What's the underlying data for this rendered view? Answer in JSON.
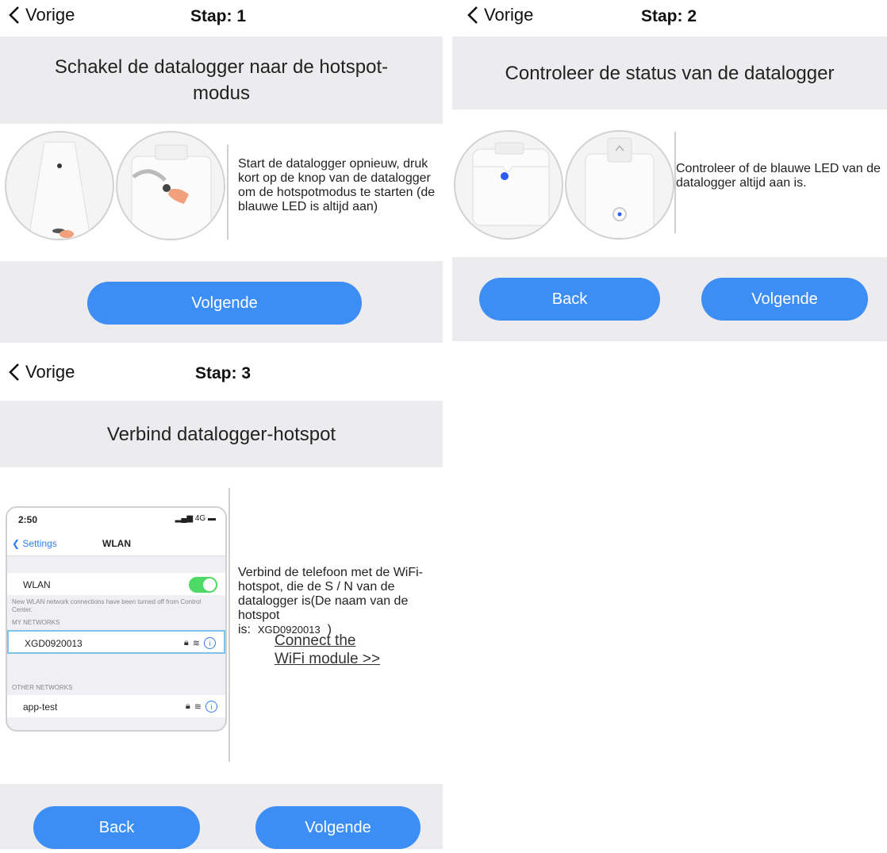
{
  "step1": {
    "back_label": "Vorige",
    "step_title": "Stap: 1",
    "header": "Schakel de datalogger naar de hotspot-modus",
    "description": "Start de datalogger opnieuw, druk kort op de knop van de datalogger om de hotspotmodus te starten (de blauwe LED is altijd aan)",
    "next_label": "Volgende"
  },
  "step2": {
    "back_label": "Vorige",
    "step_title": "Stap: 2",
    "header": "Controleer de status van de datalogger",
    "description": "Controleer of de blauwe LED van de datalogger altijd aan is.",
    "back_button_label": "Back",
    "next_label": "Volgende"
  },
  "step3": {
    "back_label": "Vorige",
    "step_title": "Stap: 3",
    "header": "Verbind datalogger-hotspot",
    "description": "Verbind de telefoon met de WiFi-hotspot, die de S / N van de datalogger is(De naam van de hotspot",
    "hotspot_prefix": "is:",
    "hotspot_name": "XGD0920013",
    "hotspot_suffix": ")",
    "link_line1": "Connect the",
    "link_line2": "WiFi module >>",
    "back_button_label": "Back",
    "next_label": "Volgende",
    "phone": {
      "time": "2:50",
      "signal": "4G",
      "nav_back": "Settings",
      "nav_title": "WLAN",
      "wlan_label": "WLAN",
      "note": "New WLAN network connections have been turned off from Control Center.",
      "my_networks_label": "MY NETWORKS",
      "my_network": "XGD0920013",
      "other_networks_label": "OTHER NETWORKS",
      "other_network": "app-test"
    }
  },
  "colors": {
    "accent": "#3c8ef5",
    "band": "#ececee",
    "led": "#2a5cf0"
  }
}
